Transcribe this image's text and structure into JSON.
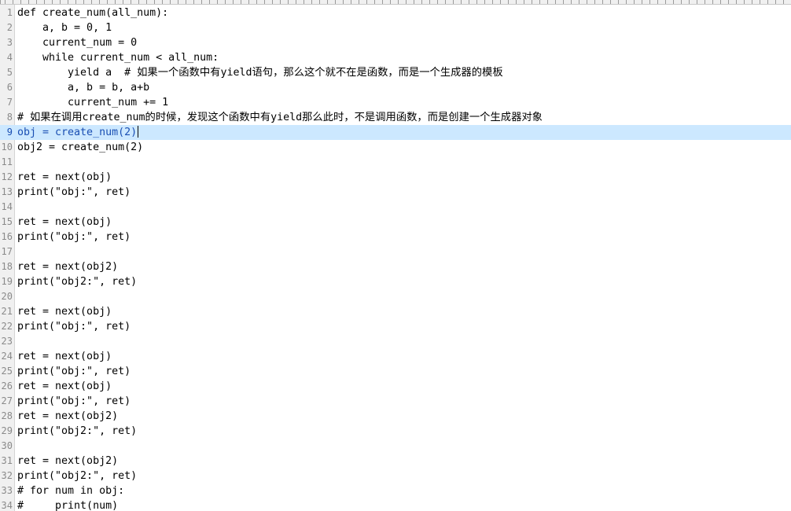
{
  "editor": {
    "current_line": 9,
    "lines": [
      {
        "n": "1",
        "code": "def create_num(all_num):"
      },
      {
        "n": "2",
        "code": "    a, b = 0, 1"
      },
      {
        "n": "3",
        "code": "    current_num = 0"
      },
      {
        "n": "4",
        "code": "    while current_num < all_num:"
      },
      {
        "n": "5",
        "code": "        yield a  # 如果一个函数中有yield语句，那么这个就不在是函数，而是一个生成器的模板"
      },
      {
        "n": "6",
        "code": "        a, b = b, a+b"
      },
      {
        "n": "7",
        "code": "        current_num += 1"
      },
      {
        "n": "8",
        "code": "# 如果在调用create_num的时候，发现这个函数中有yield那么此时，不是调用函数，而是创建一个生成器对象"
      },
      {
        "n": "9",
        "code": "obj = create_num(2)"
      },
      {
        "n": "10",
        "code": "obj2 = create_num(2)"
      },
      {
        "n": "11",
        "code": ""
      },
      {
        "n": "12",
        "code": "ret = next(obj)"
      },
      {
        "n": "13",
        "code": "print(\"obj:\", ret)"
      },
      {
        "n": "14",
        "code": ""
      },
      {
        "n": "15",
        "code": "ret = next(obj)"
      },
      {
        "n": "16",
        "code": "print(\"obj:\", ret)"
      },
      {
        "n": "17",
        "code": ""
      },
      {
        "n": "18",
        "code": "ret = next(obj2)"
      },
      {
        "n": "19",
        "code": "print(\"obj2:\", ret)"
      },
      {
        "n": "20",
        "code": ""
      },
      {
        "n": "21",
        "code": "ret = next(obj)"
      },
      {
        "n": "22",
        "code": "print(\"obj:\", ret)"
      },
      {
        "n": "23",
        "code": ""
      },
      {
        "n": "24",
        "code": "ret = next(obj)"
      },
      {
        "n": "25",
        "code": "print(\"obj:\", ret)"
      },
      {
        "n": "26",
        "code": "ret = next(obj)"
      },
      {
        "n": "27",
        "code": "print(\"obj:\", ret)"
      },
      {
        "n": "28",
        "code": "ret = next(obj2)"
      },
      {
        "n": "29",
        "code": "print(\"obj2:\", ret)"
      },
      {
        "n": "30",
        "code": ""
      },
      {
        "n": "31",
        "code": "ret = next(obj2)"
      },
      {
        "n": "32",
        "code": "print(\"obj2:\", ret)"
      },
      {
        "n": "33",
        "code": "# for num in obj:"
      },
      {
        "n": "34",
        "code": "#     print(num)"
      }
    ]
  }
}
